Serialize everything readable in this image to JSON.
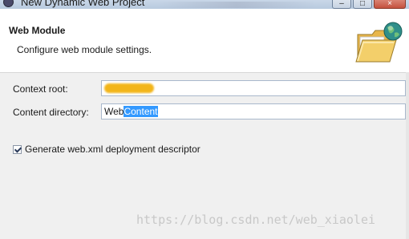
{
  "window": {
    "title": "New Dynamic Web Project",
    "minimize_glyph": "–",
    "maximize_glyph": "□",
    "close_glyph": "×"
  },
  "header": {
    "title": "Web Module",
    "description": "Configure web module settings.",
    "icon": "folder-globe-icon"
  },
  "form": {
    "context_root": {
      "label": "Context root:",
      "value": ""
    },
    "content_directory": {
      "label": "Content directory:",
      "value_unselected": "Web",
      "value_selected": "Content"
    },
    "generate_web_xml": {
      "label": "Generate web.xml deployment descriptor",
      "checked": true
    }
  },
  "watermark": "https://blog.csdn.net/web_xiaolei",
  "colors": {
    "selection": "#3399ff",
    "redaction": "#f2b51a",
    "field_border": "#a9b8cc"
  }
}
